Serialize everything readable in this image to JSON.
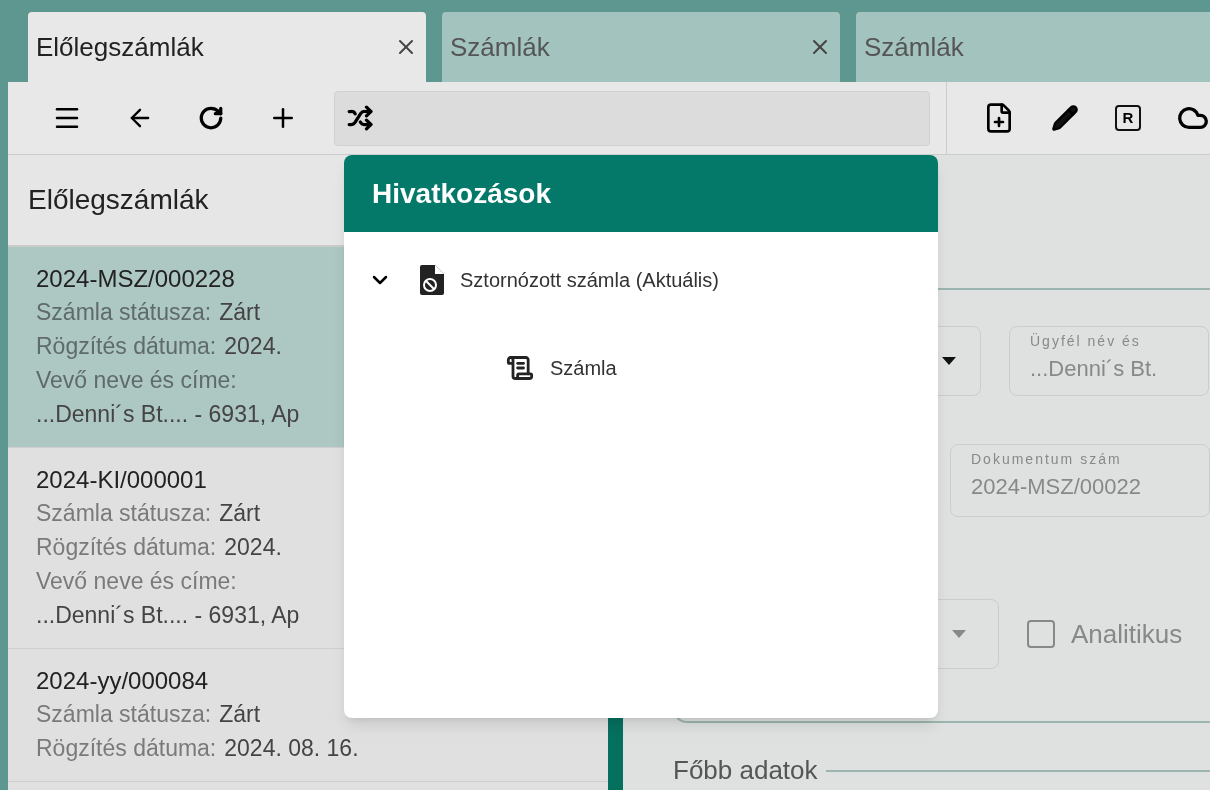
{
  "tabs": [
    {
      "label": "Előlegszámlák",
      "selected": true,
      "closable": true
    },
    {
      "label": "Számlák",
      "selected": false,
      "closable": true
    },
    {
      "label": "Számlák",
      "selected": false
    }
  ],
  "toolbar": {
    "badge_key": "R"
  },
  "list": {
    "title": "Előlegszámlák",
    "items": [
      {
        "number": "2024-MSZ/000228",
        "selected": true,
        "fields": [
          {
            "label": "Számla státusza:",
            "value": "Zárt"
          },
          {
            "label": "Rögzítés dátuma:",
            "value": "2024."
          },
          {
            "label": "Vevő neve és címe:"
          }
        ],
        "address": "...Denni´s Bt.... - 6931, Ap"
      },
      {
        "number": "2024-KI/000001",
        "selected": false,
        "fields": [
          {
            "label": "Számla státusza:",
            "value": "Zárt"
          },
          {
            "label": "Rögzítés dátuma:",
            "value": "2024."
          },
          {
            "label": "Vevő neve és címe:"
          }
        ],
        "address": "...Denni´s Bt.... - 6931, Ap"
      },
      {
        "number": "2024-yy/000084",
        "selected": false,
        "fields": [
          {
            "label": "Számla státusza:",
            "value": "Zárt"
          },
          {
            "label": "Rögzítés dátuma:",
            "value": "2024. 08. 16."
          }
        ]
      }
    ]
  },
  "popup": {
    "title": "Hivatkozások",
    "tree": [
      {
        "label": "Sztornózott számla (Aktuális)",
        "expanded": true,
        "kind": "voided",
        "children": [
          {
            "label": "Számla",
            "kind": "invoice"
          }
        ]
      }
    ]
  },
  "form": {
    "customer": {
      "label": "Ügyfél név és",
      "value": "...Denni´s Bt."
    },
    "document": {
      "label": "Dokumentum szám",
      "value": "2024-MSZ/00022"
    },
    "analytic": {
      "label": "Analitikus",
      "checked": false
    },
    "section": "Főbb adatok"
  }
}
